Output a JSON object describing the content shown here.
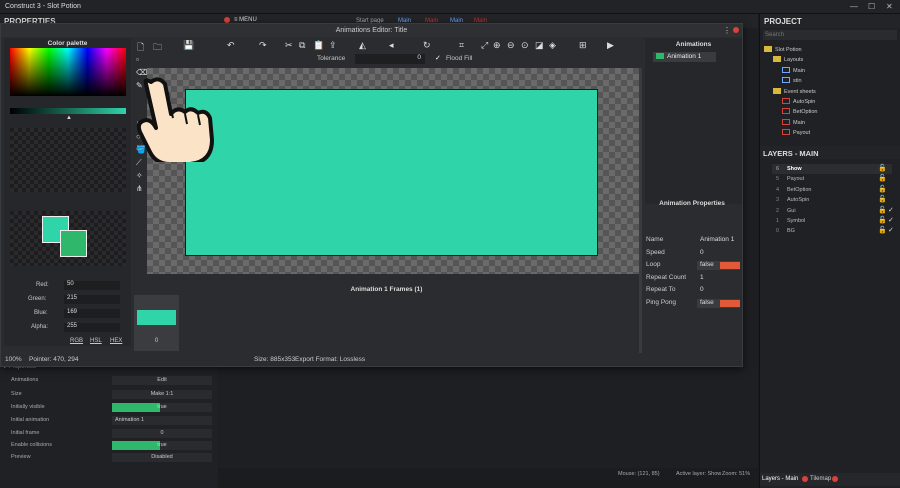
{
  "app": {
    "title": "Construct 3 - Slot Potion"
  },
  "main_toolbar": {
    "menu": "MENU",
    "start_page": "Start page",
    "tab_main": "Main",
    "tab2": "Main",
    "tab3": "Main",
    "tab4": "Main"
  },
  "left_panel": {
    "title": "PROPERTIES",
    "section": "Properties",
    "rows": [
      {
        "label": "Animations",
        "value": "Edit"
      },
      {
        "label": "Size",
        "value": "Make 1:1"
      },
      {
        "label": "Initially visible",
        "value": "true"
      },
      {
        "label": "Initial animation",
        "value": "Animation 1"
      },
      {
        "label": "Initial frame",
        "value": "0"
      },
      {
        "label": "Enable collisions",
        "value": "true"
      },
      {
        "label": "Preview",
        "value": "Disabled"
      }
    ]
  },
  "dialog": {
    "title": "Animations Editor: Title",
    "tolerance_label": "Tolerance",
    "tolerance_value": "0",
    "flood_fill_label": "Flood Fill",
    "palette": {
      "title": "Color palette",
      "red_label": "Red:",
      "red": "50",
      "green_label": "Green:",
      "green": "215",
      "blue_label": "Blue:",
      "blue": "169",
      "alpha_label": "Alpha:",
      "alpha": "255",
      "rgb": "RGB",
      "hsl": "HSL",
      "hex": "HEX"
    },
    "animations_header": "Animations",
    "animation_item": "Animation 1",
    "anim_props_title": "Animation Properties",
    "anim_props": [
      {
        "label": "Name",
        "value": "Animation 1"
      },
      {
        "label": "Speed",
        "value": "0"
      },
      {
        "label": "Loop",
        "value": "false"
      },
      {
        "label": "Repeat Count",
        "value": "1"
      },
      {
        "label": "Repeat To",
        "value": "0"
      },
      {
        "label": "Ping Pong",
        "value": "false"
      }
    ],
    "frames_title": "Animation 1 Frames (1)",
    "frame_index": "0",
    "status": {
      "zoom": "100%",
      "pointer": "Pointer: 470, 294",
      "size": "Size: 885x353",
      "format": "Export Format: Lossless"
    }
  },
  "right": {
    "project_title": "PROJECT",
    "search_placeholder": "Search",
    "tree": [
      {
        "label": "Slot Potion",
        "level": 0,
        "kind": "folder"
      },
      {
        "label": "Layouts",
        "level": 1,
        "kind": "folder"
      },
      {
        "label": "Main",
        "level": 2,
        "kind": "layout"
      },
      {
        "label": "stin",
        "level": 2,
        "kind": "layout"
      },
      {
        "label": "Event sheets",
        "level": 1,
        "kind": "folder"
      },
      {
        "label": "AutoSpin",
        "level": 2,
        "kind": "event"
      },
      {
        "label": "BetOption",
        "level": 2,
        "kind": "event"
      },
      {
        "label": "Main",
        "level": 2,
        "kind": "event"
      },
      {
        "label": "Payout",
        "level": 2,
        "kind": "event"
      }
    ],
    "layers_title": "LAYERS - MAIN",
    "layers": [
      {
        "num": "6",
        "name": "Show"
      },
      {
        "num": "5",
        "name": "Payout"
      },
      {
        "num": "4",
        "name": "BetOption"
      },
      {
        "num": "3",
        "name": "AutoSpin"
      },
      {
        "num": "2",
        "name": "Gui"
      },
      {
        "num": "1",
        "name": "Symbol"
      },
      {
        "num": "0",
        "name": "BG"
      }
    ],
    "bottom_tab1": "Layers - Main",
    "bottom_tab2": "Tilemap"
  },
  "bottom_status": {
    "mouse": "Mouse: (121, 85)",
    "active_layer": "Active layer: Show",
    "zoom": "Zoom: 51%"
  },
  "colors": {
    "accent": "#2fd4a9",
    "red": "#d9413b"
  }
}
